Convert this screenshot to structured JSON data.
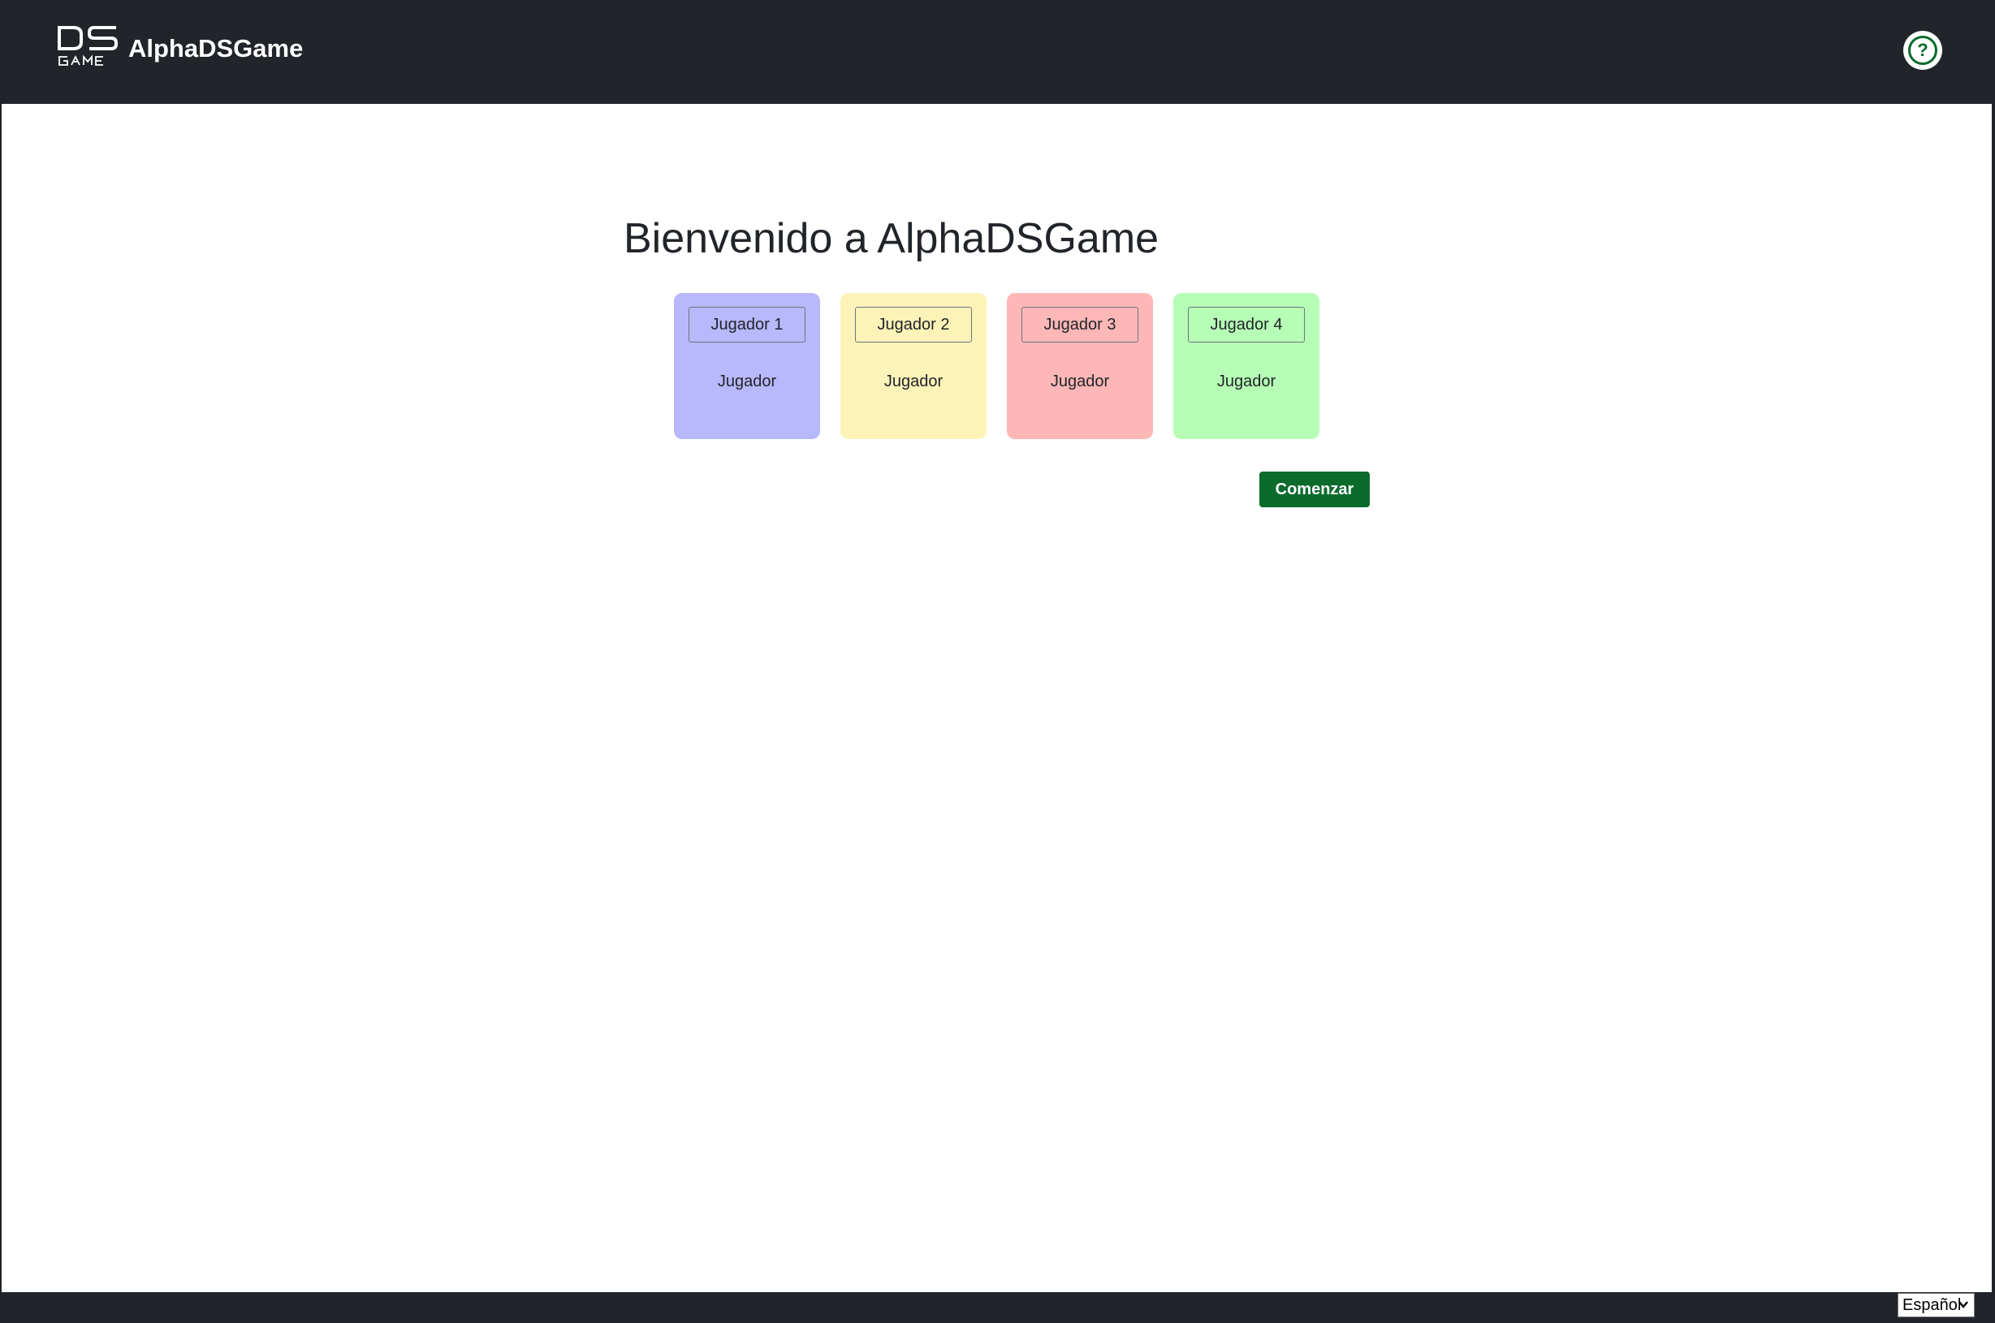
{
  "header": {
    "logo_icon": "ds-game-logo-icon",
    "app_name": "AlphaDSGame",
    "help_icon": "question-circle-icon"
  },
  "main": {
    "title": "Bienvenido a AlphaDSGame",
    "players": [
      {
        "name": "Jugador 1",
        "role": "Jugador",
        "color": "#b8b8fc"
      },
      {
        "name": "Jugador 2",
        "role": "Jugador",
        "color": "#fdf3b8"
      },
      {
        "name": "Jugador 3",
        "role": "Jugador",
        "color": "#feb7b7"
      },
      {
        "name": "Jugador 4",
        "role": "Jugador",
        "color": "#b6fdb6"
      }
    ],
    "start_label": "Comenzar"
  },
  "footer": {
    "language_selected": "Español",
    "language_icon": "chevron-down-icon"
  },
  "colors": {
    "navbar": "#212529",
    "accent_green": "#0a6b2c",
    "background": "#ffffff"
  }
}
